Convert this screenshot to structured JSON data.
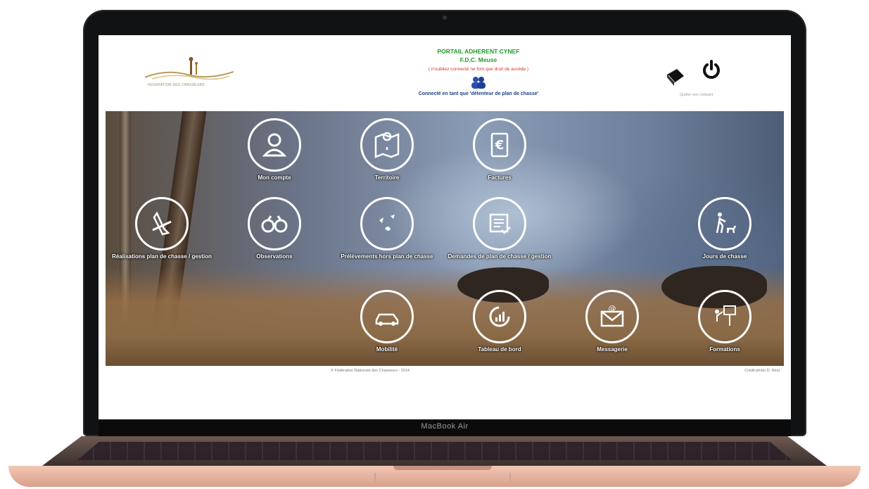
{
  "device": {
    "brand_label": "MacBook Air"
  },
  "header": {
    "portal_title": "PORTAIL ADHERENT CYNEF",
    "portal_subtitle": "F.D.C. Meuse",
    "warning": "( n'oubliez connecté ne font que droit de accède )",
    "connected_as": "Connecté en tant que 'détenteur de plan de chasse'",
    "logo_caption": "FEDERATION DES CHASSEURS",
    "power_caption": "Quitter son cotisant"
  },
  "menu": [
    {
      "id": "mon-compte",
      "label": "Mon compte",
      "icon": "user-icon"
    },
    {
      "id": "territoire",
      "label": "Territoire",
      "icon": "map-pin-icon"
    },
    {
      "id": "factures",
      "label": "Factures",
      "icon": "euro-document-icon"
    },
    {
      "id": "realisation",
      "label": "Réalisations plan de chasse / gestion",
      "icon": "hunting-knife-icon"
    },
    {
      "id": "observations",
      "label": "Observations",
      "icon": "binoculars-icon"
    },
    {
      "id": "prelevements",
      "label": "Prélèvements hors plan de chasse",
      "icon": "wildlife-icon"
    },
    {
      "id": "demandes",
      "label": "Demandes de plan de chasse / gestion",
      "icon": "form-check-icon"
    },
    {
      "id": "jours",
      "label": "Jours de chasse",
      "icon": "hunter-dog-icon"
    },
    {
      "id": "mobilite",
      "label": "Mobilité",
      "icon": "car-icon"
    },
    {
      "id": "tableau",
      "label": "Tableau de bord",
      "icon": "dashboard-chart-icon"
    },
    {
      "id": "messagerie",
      "label": "Messagerie",
      "icon": "email-icon"
    },
    {
      "id": "formations",
      "label": "Formations",
      "icon": "presentation-icon"
    }
  ],
  "footer": {
    "copyright": "© Fédération Nationale des Chasseurs - 2014",
    "photo_credit": "Crédit photo D. Rest"
  }
}
